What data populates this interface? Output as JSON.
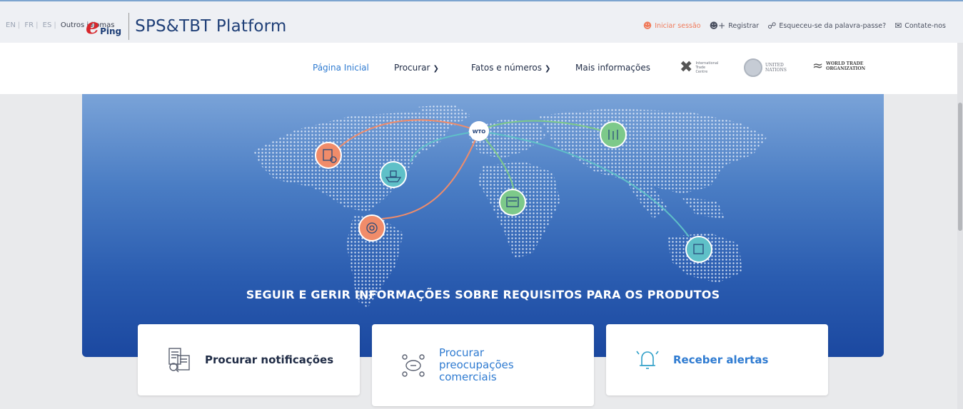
{
  "topbar": {
    "languages": [
      "EN",
      "FR",
      "ES"
    ],
    "other_languages": "Outros idiomas",
    "login": "Iniciar sessão",
    "register": "Registrar",
    "forgot": "Esqueceu-se da palavra-passe?",
    "contact": "Contate-nos"
  },
  "header": {
    "logo_e": "e",
    "logo_ping": "Ping",
    "title": "SPS&TBT Platform",
    "nav": {
      "home": "Página Inicial",
      "search": "Procurar",
      "facts": "Fatos e números",
      "more": "Mais informações"
    },
    "partners": {
      "itc": "International Trade Centre",
      "un": "UNITED NATIONS",
      "wto": "WORLD TRADE ORGANIZATION"
    }
  },
  "hero": {
    "hub_label": "WTO",
    "title": "SEGUIR E GERIR INFORMAÇÕES SOBRE REQUISITOS PARA OS PRODUTOS"
  },
  "cards": [
    {
      "label": "Procurar notificações",
      "icon": "document-search-icon"
    },
    {
      "label": "Procurar preocupações comerciais",
      "icon": "discussion-icon"
    },
    {
      "label": "Receber alertas",
      "icon": "bell-icon"
    }
  ],
  "colors": {
    "accent": "#2f7bd1",
    "brand_red": "#d7262b",
    "navy": "#1f3f77",
    "orange_node": "#f08c6a",
    "teal_node": "#5fc0c8",
    "green_node": "#7dc98a"
  }
}
